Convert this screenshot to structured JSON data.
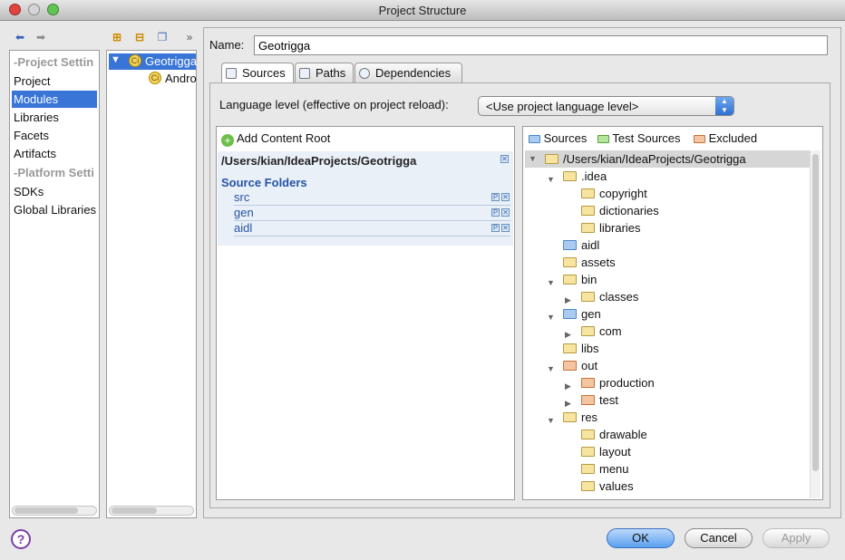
{
  "window": {
    "title": "Project Structure"
  },
  "nav": {
    "project_settings_header": "Project Settin",
    "items_project": [
      "Project",
      "Modules",
      "Libraries",
      "Facets",
      "Artifacts"
    ],
    "platform_settings_header": "Platform Setti",
    "items_platform": [
      "SDKs",
      "Global Libraries"
    ],
    "selected": "Modules"
  },
  "modules": {
    "toolbar_more": "»",
    "items": [
      {
        "label": "Geotrigga",
        "selected": true,
        "badge": "Ci"
      },
      {
        "label": "Andro",
        "badge": "Ci"
      }
    ]
  },
  "detail": {
    "name_label": "Name:",
    "name_value": "Geotrigga",
    "tabs": [
      "Sources",
      "Paths",
      "Dependencies"
    ],
    "active_tab": "Sources",
    "language_level_label": "Language level (effective on project reload):",
    "language_level_value": "<Use project language level>",
    "add_content_root": "Add Content Root",
    "content_root_path": "/Users/kian/IdeaProjects/Geotrigga",
    "source_folders_label": "Source Folders",
    "source_folders": [
      "src",
      "gen",
      "aidl"
    ],
    "legend": [
      "Sources",
      "Test Sources",
      "Excluded"
    ]
  },
  "tree": {
    "root": "/Users/kian/IdeaProjects/Geotrigga",
    "rows": [
      {
        "label": ".idea",
        "expanded": true,
        "type": "plain"
      },
      {
        "label": "copyright",
        "type": "plain"
      },
      {
        "label": "dictionaries",
        "type": "plain"
      },
      {
        "label": "libraries",
        "type": "plain"
      },
      {
        "label": "aidl",
        "type": "source"
      },
      {
        "label": "assets",
        "type": "plain"
      },
      {
        "label": "bin",
        "expanded": true,
        "type": "plain"
      },
      {
        "label": "classes",
        "collapsed": true,
        "type": "plain"
      },
      {
        "label": "gen",
        "expanded": true,
        "type": "source"
      },
      {
        "label": "com",
        "collapsed": true,
        "type": "package"
      },
      {
        "label": "libs",
        "type": "plain"
      },
      {
        "label": "out",
        "expanded": true,
        "type": "excluded"
      },
      {
        "label": "production",
        "collapsed": true,
        "type": "excluded"
      },
      {
        "label": "test",
        "collapsed": true,
        "type": "excluded"
      },
      {
        "label": "res",
        "expanded": true,
        "type": "plain"
      },
      {
        "label": "drawable",
        "type": "plain"
      },
      {
        "label": "layout",
        "type": "plain"
      },
      {
        "label": "menu",
        "type": "plain"
      },
      {
        "label": "values",
        "type": "plain"
      }
    ]
  },
  "footer": {
    "help": "?",
    "ok": "OK",
    "cancel": "Cancel",
    "apply": "Apply"
  },
  "colors": {
    "selection": "#3875d7",
    "source_folder": "#5b9bd5",
    "test_folder": "#6cbf4a",
    "excluded_folder": "#e8a070",
    "plain_folder": "#f3d77a",
    "help_circle": "#7b3fa8"
  }
}
